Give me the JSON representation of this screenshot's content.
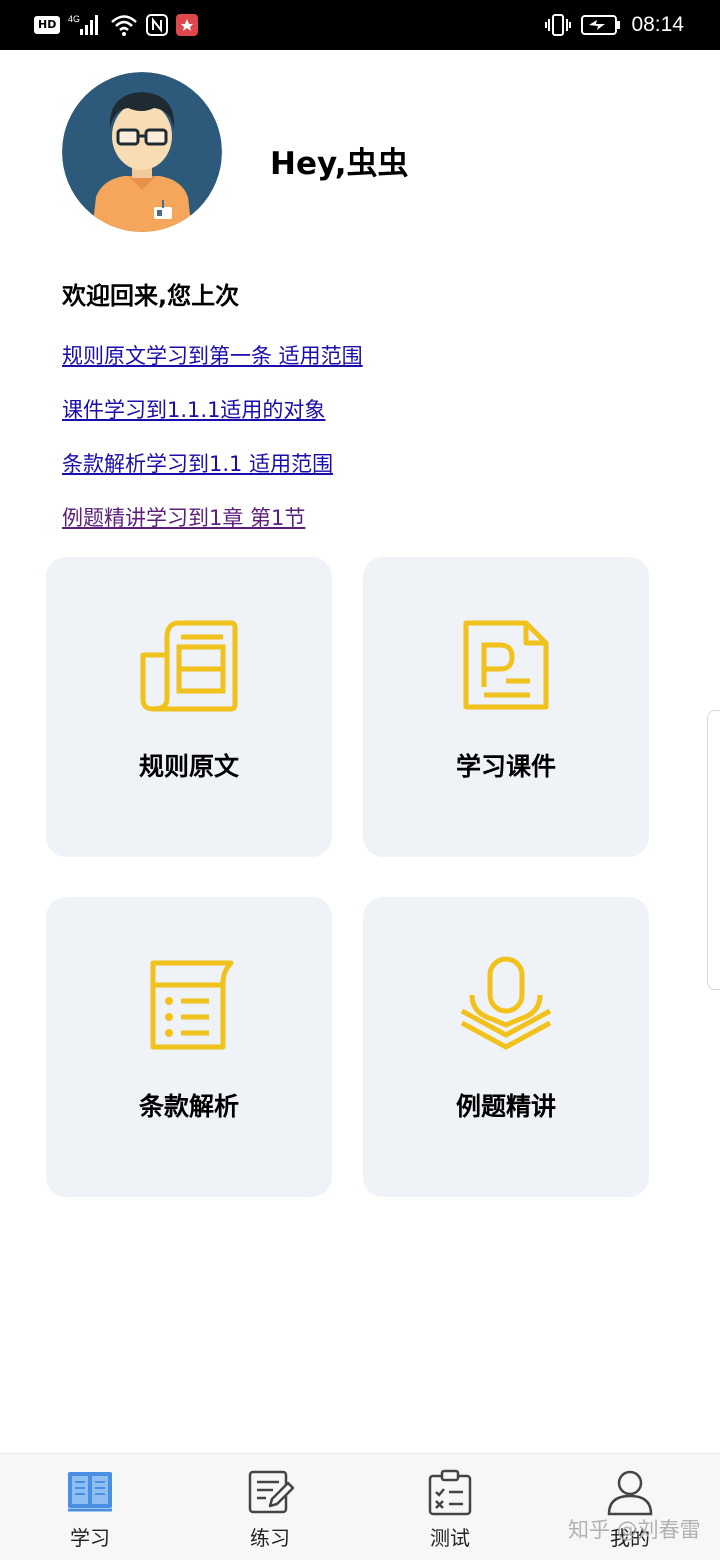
{
  "status_bar": {
    "hd_badge": "HD",
    "network": "4G",
    "time": "08:14"
  },
  "profile": {
    "greeting": "Hey,虫虫",
    "avatar_icon": "user-avatar-glasses"
  },
  "welcome": {
    "title": "欢迎回来,您上次",
    "links": [
      "规则原文学习到第一条 适用范围",
      "课件学习到1.1.1适用的对象",
      "条款解析学习到1.1 适用范围",
      "例题精讲学习到1章 第1节"
    ]
  },
  "modules": [
    {
      "label": "规则原文",
      "icon": "newspaper-icon"
    },
    {
      "label": "学习课件",
      "icon": "ppt-file-icon"
    },
    {
      "label": "条款解析",
      "icon": "list-document-icon"
    },
    {
      "label": "例题精讲",
      "icon": "microphone-layers-icon"
    }
  ],
  "colors": {
    "accent_icon": "#f2c21c",
    "card_bg": "#eff3f8",
    "link": "#1a0dab",
    "active_tab": "#4a90e2"
  },
  "bottom_nav": {
    "items": [
      {
        "label": "学习",
        "icon": "book-icon",
        "active": true
      },
      {
        "label": "练习",
        "icon": "edit-note-icon",
        "active": false
      },
      {
        "label": "测试",
        "icon": "clipboard-check-icon",
        "active": false
      },
      {
        "label": "我的",
        "icon": "person-icon",
        "active": false
      }
    ]
  },
  "watermark": "知乎 @刘春雷"
}
